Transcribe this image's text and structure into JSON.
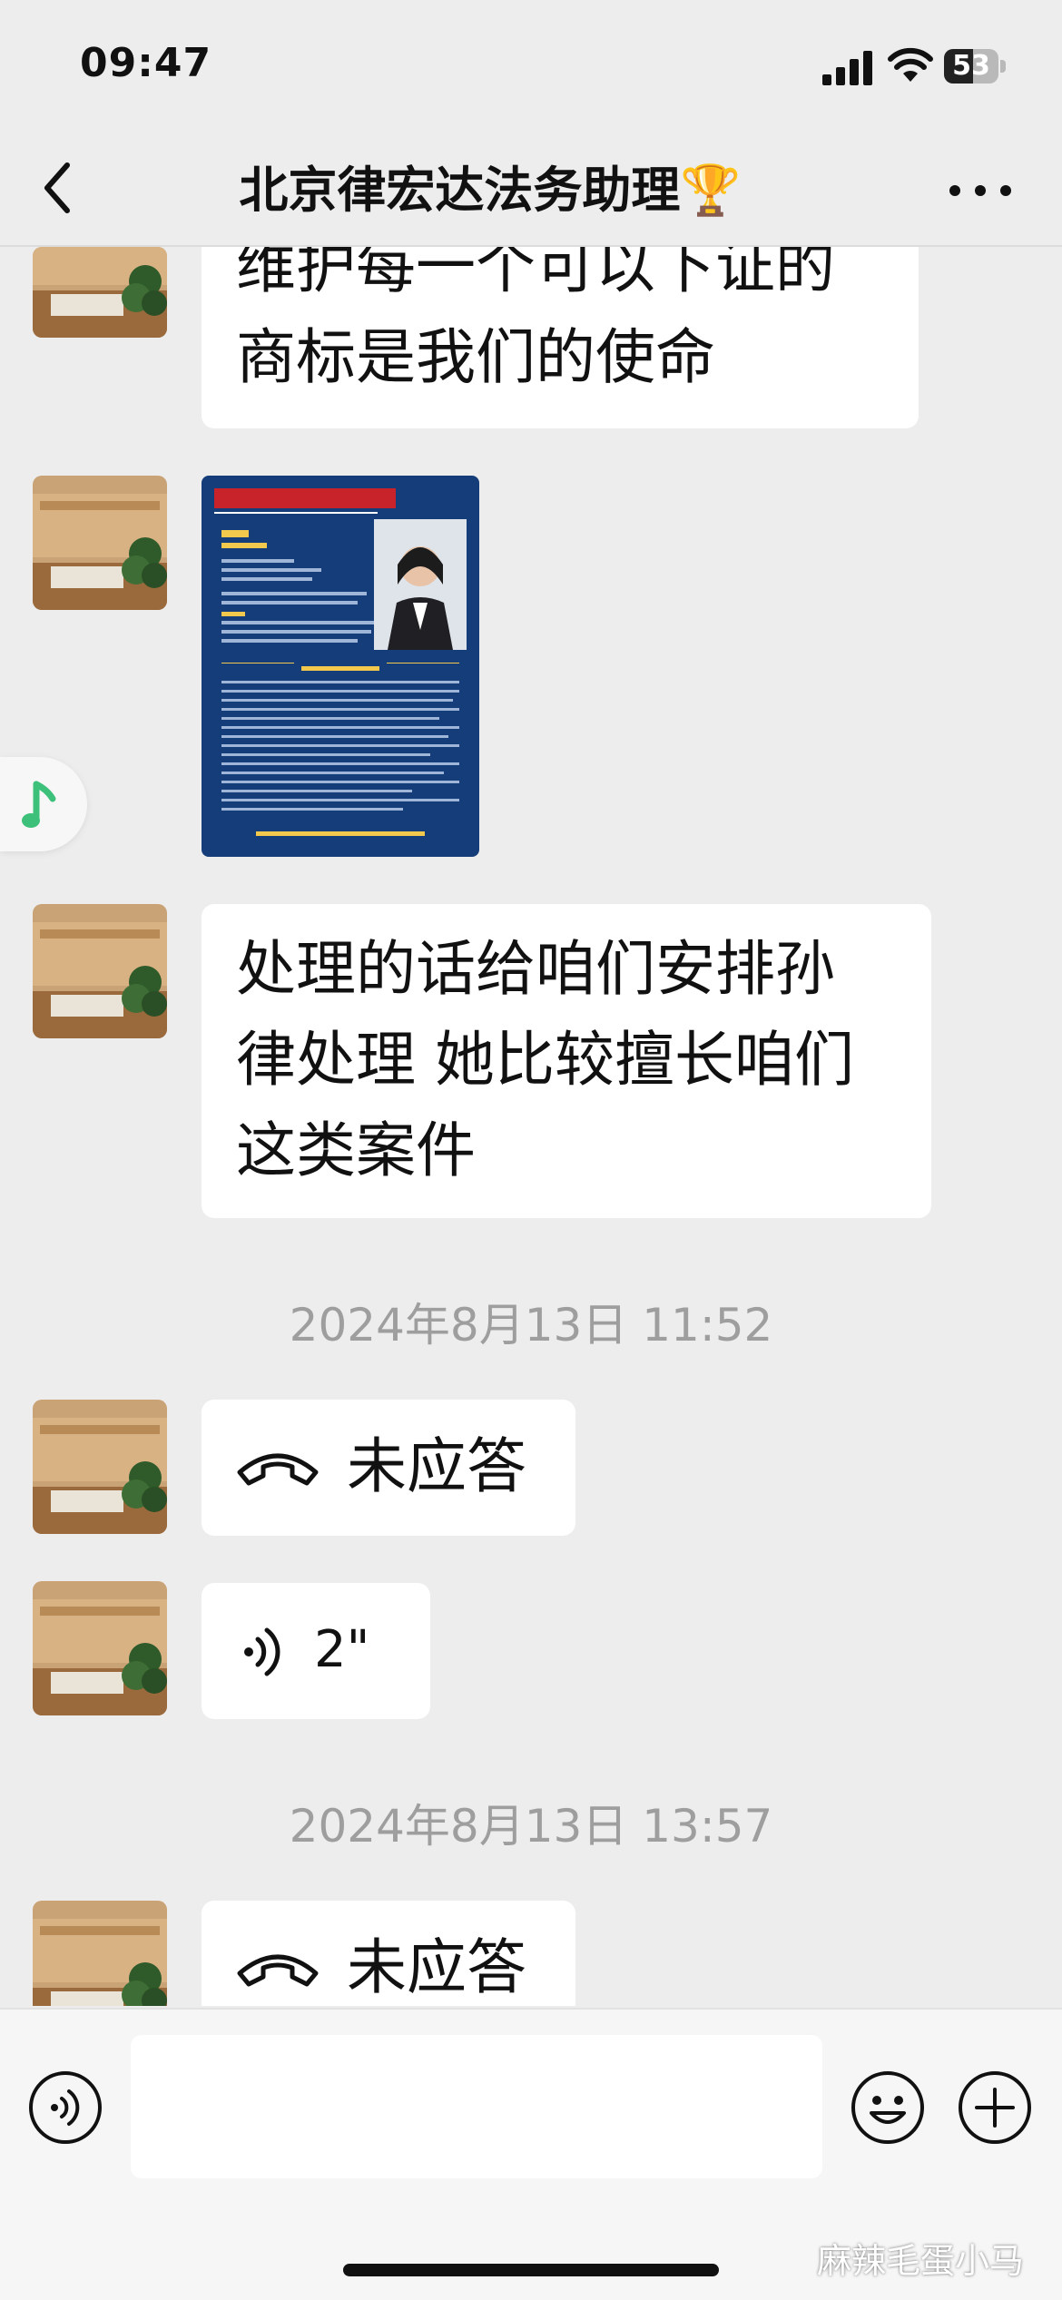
{
  "status_bar": {
    "time": "09:47",
    "battery": "53",
    "battery_level": 0.53,
    "icons": [
      "cellular-signal-icon",
      "wifi-icon",
      "battery-icon"
    ]
  },
  "nav": {
    "title": "北京律宏达法务助理🏆",
    "back_icon": "chevron-left-icon",
    "more_icon": "more-dots-icon"
  },
  "messages": [
    {
      "type": "text",
      "sender": "other",
      "text": "维护每一个可以下证的\n商标是我们的使命"
    },
    {
      "type": "image",
      "sender": "other",
      "icon": "lawyer-profile-card-image"
    },
    {
      "type": "text",
      "sender": "other",
      "text": "处理的话给咱们安排孙\n律处理 她比较擅长咱们\n这类案件"
    },
    {
      "type": "timestamp",
      "text": "2024年8月13日 11:52"
    },
    {
      "type": "call",
      "sender": "other",
      "icon": "phone-hangup-icon",
      "text": "未应答"
    },
    {
      "type": "voice",
      "sender": "other",
      "icon": "voice-wave-icon",
      "duration": "2\""
    },
    {
      "type": "timestamp",
      "text": "2024年8月13日 13:57"
    },
    {
      "type": "call",
      "sender": "other",
      "icon": "phone-hangup-icon",
      "text": "未应答"
    }
  ],
  "floating": {
    "icon": "music-note-icon"
  },
  "input_bar": {
    "placeholder": "",
    "voice_icon": "voice-input-icon",
    "emoji_icon": "emoji-icon",
    "add_icon": "plus-circle-icon"
  },
  "watermark": "麻辣毛蛋小马",
  "colors": {
    "background": "#ededed",
    "bubble": "#ffffff",
    "accent": "#07c160",
    "timestamp": "#9e9e9e"
  }
}
